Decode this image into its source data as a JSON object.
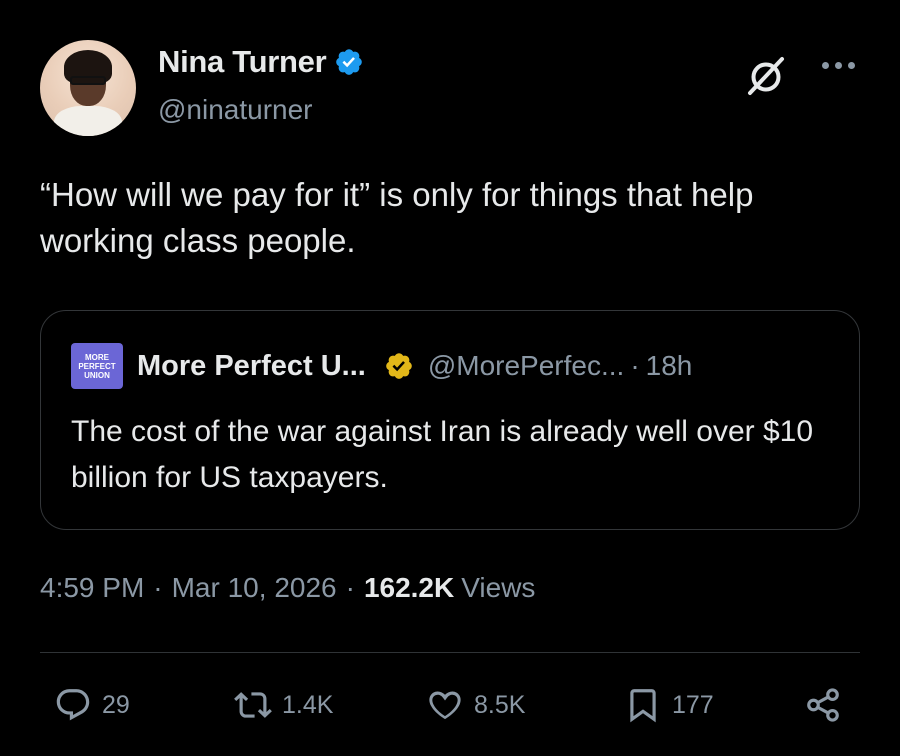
{
  "author": {
    "display_name": "Nina Turner",
    "handle": "@ninaturner",
    "verified_color": "#1d9bf0"
  },
  "tweet": {
    "text": "“How will we pay for it” is only for things that help working class people."
  },
  "quote": {
    "logo_text": [
      "MORE",
      "PERFECT",
      "UNION"
    ],
    "display_name": "More Perfect U...",
    "badge_color": "#e2b719",
    "handle": "@MorePerfec...",
    "separator": "·",
    "time": "18h",
    "text": "The cost of the war against Iran is already well over $10 billion for US taxpayers."
  },
  "meta": {
    "time": "4:59 PM",
    "separator": "·",
    "date": "Mar 10, 2026",
    "views_count": "162.2K",
    "views_label": "Views"
  },
  "actions": {
    "replies": "29",
    "reposts": "1.4K",
    "likes": "8.5K",
    "bookmarks": "177"
  },
  "icons": {
    "header": [
      "grok-icon",
      "more-icon"
    ],
    "actions": [
      "reply-icon",
      "repost-icon",
      "like-icon",
      "bookmark-icon",
      "share-icon"
    ]
  }
}
